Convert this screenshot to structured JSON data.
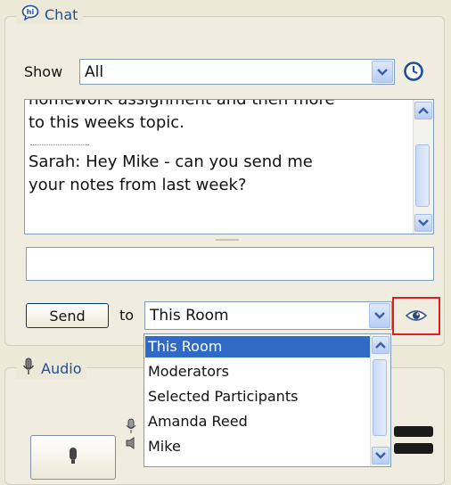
{
  "chat": {
    "title": "Chat",
    "show_label": "Show",
    "show_value": "All",
    "messages": [
      "homework assignment and then more",
      "to this weeks topic.",
      "Sarah: Hey Mike - can you send me",
      "your notes from last week?"
    ],
    "input_value": "",
    "send_label": "Send",
    "to_label": "to",
    "recipient_value": "This Room",
    "recipient_options": [
      "This Room",
      "Moderators",
      "Selected Participants",
      "Amanda Reed",
      "Mike"
    ]
  },
  "audio": {
    "title": "Audio"
  },
  "colors": {
    "accent": "#1f4e9c",
    "highlight": "#e02020",
    "selection": "#316ac5"
  }
}
